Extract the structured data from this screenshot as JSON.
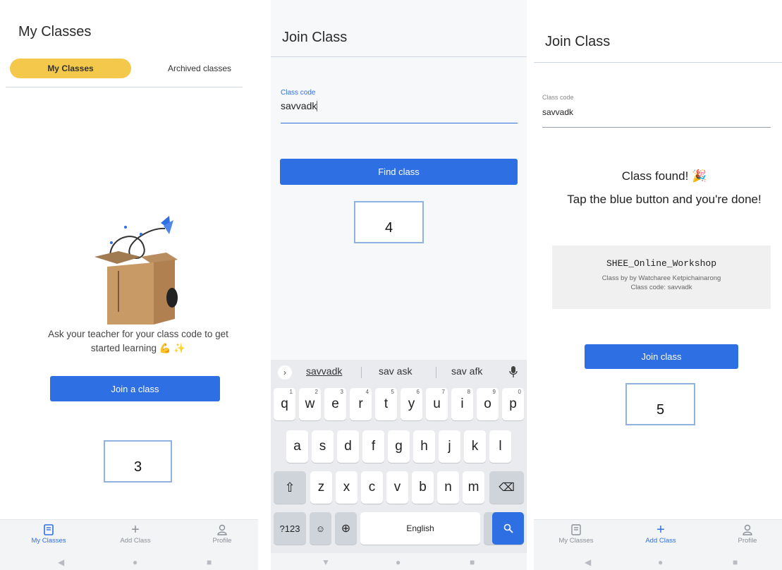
{
  "panel1": {
    "title": "My Classes",
    "tabs": [
      "My Classes",
      "Archived classes"
    ],
    "message": "Ask your teacher for your class code to get started learning 💪 ✨",
    "join_button": "Join a class",
    "step": "3"
  },
  "panel2": {
    "title": "Join Class",
    "field_label": "Class code",
    "field_value": "savvadk",
    "find_button": "Find class",
    "step": "4",
    "keyboard": {
      "suggestions": [
        "savvadk",
        "sav ask",
        "sav afk"
      ],
      "row1": [
        "q",
        "w",
        "e",
        "r",
        "t",
        "y",
        "u",
        "i",
        "o",
        "p"
      ],
      "row1_digits": [
        "1",
        "2",
        "3",
        "4",
        "5",
        "6",
        "7",
        "8",
        "9",
        "0"
      ],
      "row2": [
        "a",
        "s",
        "d",
        "f",
        "g",
        "h",
        "j",
        "k",
        "l"
      ],
      "row3": [
        "z",
        "x",
        "c",
        "v",
        "b",
        "n",
        "m"
      ],
      "symbols_key": "?123",
      "space_label": "English",
      "period": "."
    }
  },
  "panel3": {
    "title": "Join Class",
    "field_label": "Class code",
    "field_value": "savvadk",
    "found_line1": "Class found! 🎉",
    "found_line2": "Tap the blue button and you're done!",
    "class_name": "SHEE_Online_Workshop",
    "class_by": "Class by by Watcharee Ketpichainarong",
    "class_code": "Class code: savvadk",
    "join_button": "Join class",
    "step": "5"
  },
  "nav": {
    "my_classes": "My Classes",
    "add_class": "Add Class",
    "profile": "Profile"
  },
  "colors": {
    "accent_blue": "#2f6fe4",
    "tab_yellow": "#f4c84a",
    "step_border": "#8fb2e0"
  }
}
